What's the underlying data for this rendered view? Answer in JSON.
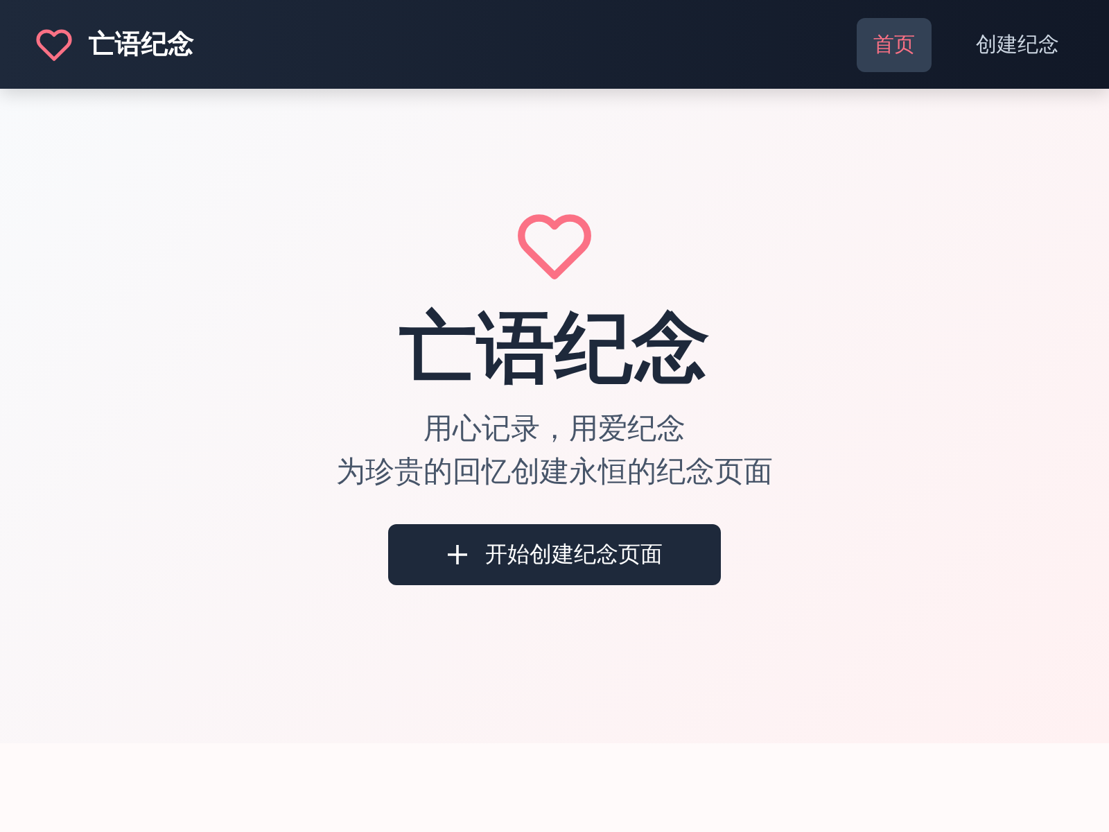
{
  "header": {
    "brand": "亡语纪念",
    "nav": [
      {
        "label": "首页",
        "selected": true
      },
      {
        "label": "创建纪念",
        "selected": false
      }
    ]
  },
  "hero": {
    "title": "亡语纪念",
    "subtitle_lines": [
      "用心记录，用爱纪念",
      "为珍贵的回忆创建永恒的纪念页面"
    ],
    "button": "开始创建纪念页面"
  }
}
